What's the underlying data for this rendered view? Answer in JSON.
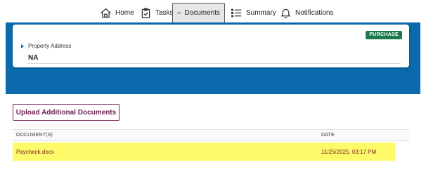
{
  "nav": {
    "items": [
      {
        "label": "Home",
        "icon": "home-icon"
      },
      {
        "label": "Tasks",
        "icon": "clipboard-check-icon"
      },
      {
        "label": "Documents",
        "icon": "cloud-upload-icon"
      },
      {
        "label": "Summary",
        "icon": "list-icon"
      },
      {
        "label": "Notifications",
        "icon": "bell-icon"
      }
    ],
    "active": "Documents"
  },
  "property": {
    "badge": "PURCHASE",
    "label": "Property Address",
    "value": "NA"
  },
  "upload_button": "Upload Additional Documents",
  "documents": {
    "headers": {
      "document": "DOCUMENT(S)",
      "date": "DATE"
    },
    "rows": [
      {
        "name": "Paycheck.docx",
        "date": "11/25/2025, 03:17 PM"
      }
    ]
  },
  "colors": {
    "band": "#0a6aab",
    "badge": "#1f7a4d",
    "upload_button_text": "#6b1f4d",
    "highlight": "#fdfb6a"
  }
}
